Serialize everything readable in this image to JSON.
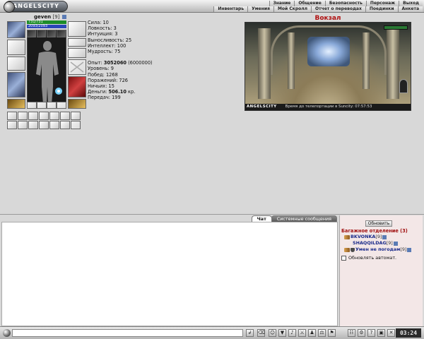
{
  "topbar": {
    "logo": "ANGELSCITY",
    "menu_row1": [
      "Знание",
      "Общение",
      "Безопасность",
      "Персонаж",
      "Выход"
    ],
    "menu_row2": [
      "Инвентарь",
      "Умения",
      "Мой Скролл",
      "Отчет о переводах",
      "Поединки",
      "Анкета"
    ]
  },
  "character": {
    "name": "geven",
    "level": "[9]",
    "hp": "731/731",
    "mana": "2093/2093"
  },
  "stats": {
    "strength": "Сила: 10",
    "agility": "Ловкость: 3",
    "intuition": "Интуиция: 3",
    "endurance": "Выносливость: 25",
    "intellect": "Интеллект: 100",
    "wisdom": "Мудрость: 75",
    "exp_label": "Опыт: ",
    "exp_value": "3052060",
    "exp_next": " (6000000)",
    "level_line": "Уровень: 9",
    "wins": "Побед: 1268",
    "losses": "Поражений: 726",
    "draws": "Ничьих: 15",
    "money_label": "Деньги: ",
    "money_value": "506.10",
    "money_unit": " кр.",
    "transfers": "Передач: 199"
  },
  "location": {
    "title": "Вокзал",
    "status_logo": "ANGELSCITY",
    "status_text": "Время до телепортации в Suncity: 07:57:53"
  },
  "chat": {
    "tabs": [
      "Чат",
      "Системные сообщения"
    ]
  },
  "side": {
    "refresh": "Обновить",
    "room": "Багажное отделение (3)",
    "players": [
      {
        "name": "BKVONKA",
        "level": "[9]"
      },
      {
        "name": "SHAQQILDAG",
        "level": "[9]"
      },
      {
        "name": "Умен не погодам",
        "level": "[9]"
      }
    ],
    "auto_refresh": "Обновлять автомат."
  },
  "toolbar": {
    "clock": "03:24",
    "icons": [
      "send-icon",
      "clear-icon",
      "smile-icon",
      "filter-icon",
      "sound-icon",
      "battle-icon",
      "stats-icon",
      "trade-icon",
      "clan-icon",
      "friends-icon",
      "settings-icon",
      "help-icon",
      "lock-icon",
      "quit-icon"
    ]
  },
  "colors": {
    "hp": "#1c8c2a",
    "mana": "#2a46b8",
    "location_title": "#b01010",
    "player_name": "#1a2a8a",
    "side_bg": "#f3e7e7"
  }
}
